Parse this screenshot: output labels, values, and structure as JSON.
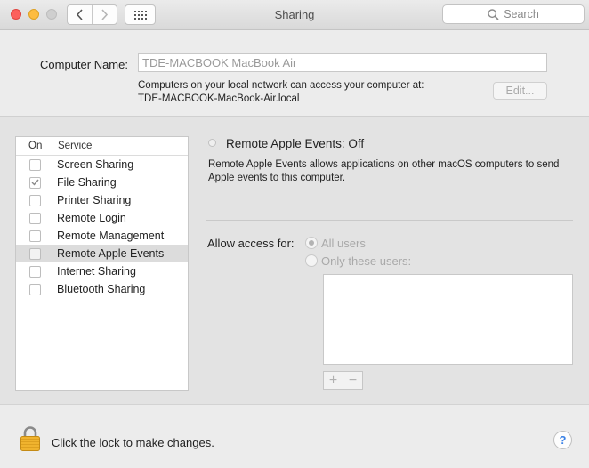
{
  "window": {
    "title": "Sharing",
    "search_placeholder": "Search"
  },
  "computer_name": {
    "label": "Computer Name:",
    "value": "TDE-MACBOOK MacBook Air",
    "network_line1": "Computers on your local network can access your computer at:",
    "network_line2": "TDE-MACBOOK-MacBook-Air.local",
    "edit_button": "Edit..."
  },
  "services": {
    "col_on": "On",
    "col_service": "Service",
    "items": [
      {
        "label": "Screen Sharing",
        "checked": false,
        "selected": false
      },
      {
        "label": "File Sharing",
        "checked": true,
        "selected": false
      },
      {
        "label": "Printer Sharing",
        "checked": false,
        "selected": false
      },
      {
        "label": "Remote Login",
        "checked": false,
        "selected": false
      },
      {
        "label": "Remote Management",
        "checked": false,
        "selected": false
      },
      {
        "label": "Remote Apple Events",
        "checked": false,
        "selected": true
      },
      {
        "label": "Internet Sharing",
        "checked": false,
        "selected": false
      },
      {
        "label": "Bluetooth Sharing",
        "checked": false,
        "selected": false
      }
    ]
  },
  "detail": {
    "status": "Remote Apple Events: Off",
    "description": "Remote Apple Events allows applications on other macOS computers to send Apple events to this computer.",
    "allow_label": "Allow access for:",
    "option_all": "All users",
    "option_only": "Only these users:",
    "selected_option": "all",
    "add_label": "+",
    "remove_label": "−"
  },
  "footer": {
    "lock_text": "Click the lock to make changes.",
    "help_label": "?"
  },
  "colors": {
    "close": "#fc605c",
    "minimize": "#fdbc40",
    "help_accent": "#3b82e6",
    "lock": "#f0b32e"
  }
}
